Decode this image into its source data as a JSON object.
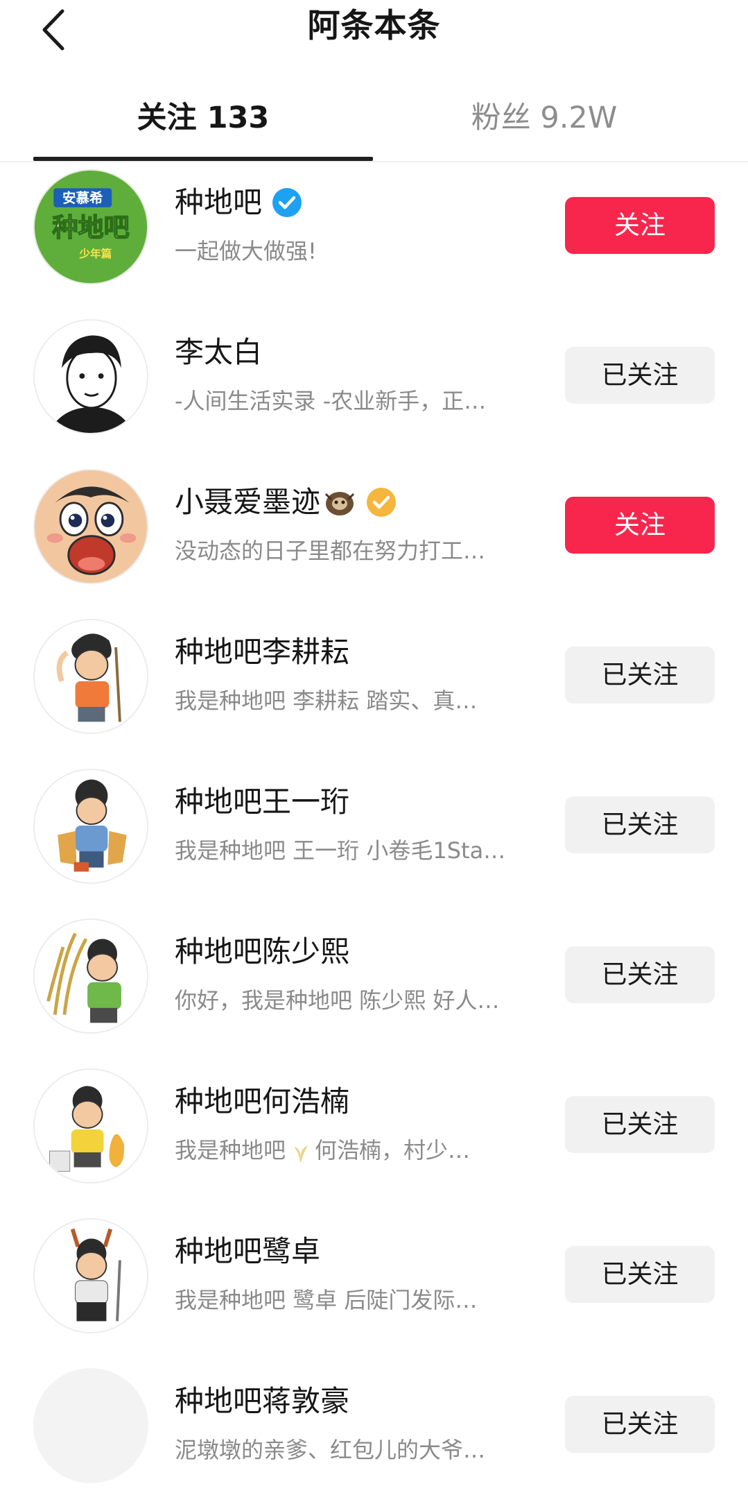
{
  "header": {
    "back_icon": "chevron-left-icon",
    "title": "阿条本条"
  },
  "tabs": [
    {
      "label": "关注 133",
      "active": true
    },
    {
      "label": "粉丝 9.2W",
      "active": false
    }
  ],
  "colors": {
    "primary_button": "#f8264c",
    "secondary_button": "#f1f1f1",
    "verified_blue": "#1da1f2",
    "verified_gold": "#f4b63d"
  },
  "users": [
    {
      "name": "种地吧",
      "bio": "一起做大做强!",
      "button": "关注",
      "followed": false,
      "badge": "verified-blue-icon",
      "avatar_text": [
        "安慕希",
        "种地吧",
        "少年篇"
      ]
    },
    {
      "name": "李太白",
      "bio": "-人间生活实录 -农业新手，正…",
      "button": "已关注",
      "followed": true
    },
    {
      "name": "小聂爱墨迹",
      "bio": "没动态的日子里都在努力打工…",
      "button": "关注",
      "followed": false,
      "badge": "verified-gold-icon",
      "name_emoji": "sloth-icon"
    },
    {
      "name": "种地吧李耕耘",
      "bio": "我是种地吧 李耕耘 踏实、真…",
      "button": "已关注",
      "followed": true
    },
    {
      "name": "种地吧王一珩",
      "bio": "我是种地吧 王一珩 小卷毛1Sta…",
      "button": "已关注",
      "followed": true
    },
    {
      "name": "种地吧陈少熙",
      "bio": "你好，我是种地吧 陈少熙 好人…",
      "button": "已关注",
      "followed": true
    },
    {
      "name": "种地吧何浩楠",
      "bio": "我是种地吧",
      "bio_rest": "何浩楠，村少…",
      "bio_icon": "sprout-icon",
      "button": "已关注",
      "followed": true
    },
    {
      "name": "种地吧鹭卓",
      "bio": "我是种地吧 鹭卓 后陡门发际…",
      "button": "已关注",
      "followed": true
    },
    {
      "name": "种地吧蒋敦豪",
      "bio": "泥墩墩的亲爹、红包儿的大爷…",
      "button": "已关注",
      "followed": true
    }
  ]
}
